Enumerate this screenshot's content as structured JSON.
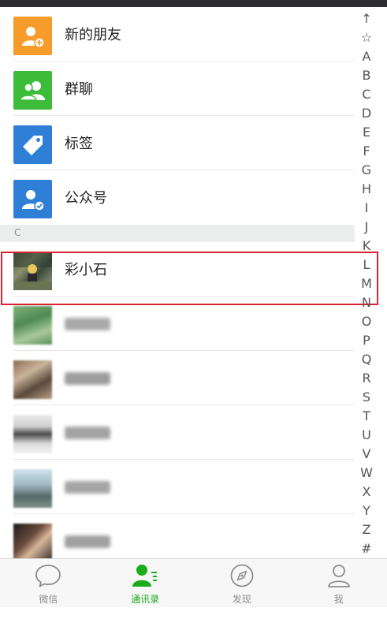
{
  "top_entries": [
    {
      "label": "新的朋友",
      "color": "#f79b2a",
      "icon": "add-friend-icon"
    },
    {
      "label": "群聊",
      "color": "#3dbb3a",
      "icon": "group-chat-icon"
    },
    {
      "label": "标签",
      "color": "#2f7fd7",
      "icon": "tag-icon"
    },
    {
      "label": "公众号",
      "color": "#2f7fd7",
      "icon": "official-account-icon"
    }
  ],
  "section": {
    "letter": "C"
  },
  "contacts": [
    {
      "name": "彩小石",
      "highlighted": true
    }
  ],
  "index_letters": [
    "↑",
    "☆",
    "A",
    "B",
    "C",
    "D",
    "E",
    "F",
    "G",
    "H",
    "I",
    "J",
    "K",
    "L",
    "M",
    "N",
    "O",
    "P",
    "Q",
    "R",
    "S",
    "T",
    "U",
    "V",
    "W",
    "X",
    "Y",
    "Z",
    "#"
  ],
  "tabbar": {
    "tabs": [
      {
        "label": "微信",
        "icon": "chat-bubble-icon",
        "active": false
      },
      {
        "label": "通讯录",
        "icon": "contacts-icon",
        "active": true
      },
      {
        "label": "发现",
        "icon": "compass-icon",
        "active": false
      },
      {
        "label": "我",
        "icon": "person-icon",
        "active": false
      }
    ]
  },
  "colors": {
    "accent": "#1aad19",
    "highlight_border": "#d9232f"
  }
}
